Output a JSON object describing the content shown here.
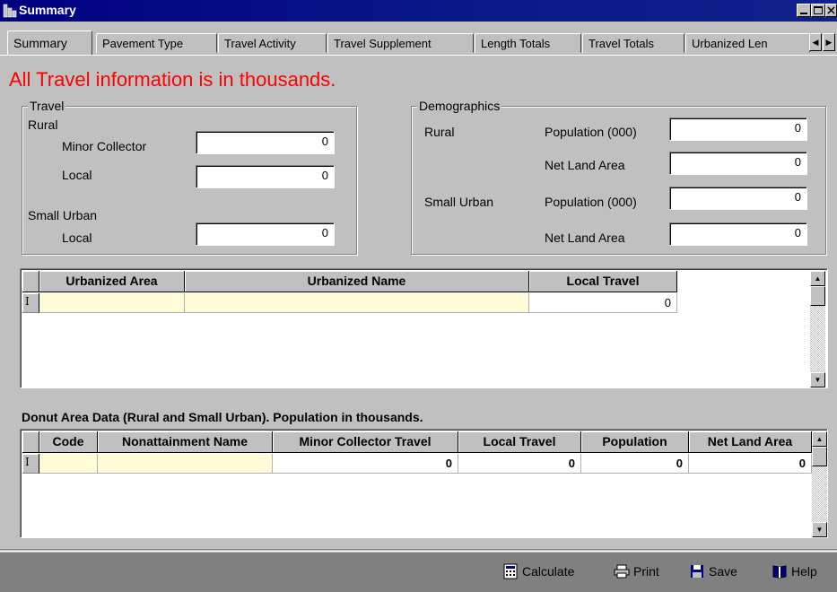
{
  "window": {
    "title": "Summary"
  },
  "tabs": [
    {
      "label": "Summary"
    },
    {
      "label": "Pavement Type"
    },
    {
      "label": "Travel Activity"
    },
    {
      "label": "Travel Supplement"
    },
    {
      "label": "Length Totals"
    },
    {
      "label": "Travel Totals"
    },
    {
      "label": "Urbanized Len"
    }
  ],
  "notice": "All Travel information is in thousands.",
  "travel": {
    "title": "Travel",
    "rural_label": "Rural",
    "minor_collector_label": "Minor Collector",
    "minor_collector_value": "0",
    "rural_local_label": "Local",
    "rural_local_value": "0",
    "small_urban_label": "Small Urban",
    "small_urban_local_label": "Local",
    "small_urban_local_value": "0"
  },
  "demographics": {
    "title": "Demographics",
    "rural_label": "Rural",
    "rural_population_label": "Population (000)",
    "rural_population_value": "0",
    "rural_net_land_label": "Net Land Area",
    "rural_net_land_value": "0",
    "small_urban_label": "Small Urban",
    "small_urban_population_label": "Population (000)",
    "small_urban_population_value": "0",
    "small_urban_net_land_label": "Net Land Area",
    "small_urban_net_land_value": "0"
  },
  "urbanized_grid": {
    "columns": [
      "Urbanized Area",
      "Urbanized Name",
      "Local Travel"
    ],
    "rows": [
      {
        "area": "",
        "name": "",
        "local_travel": "0"
      }
    ],
    "row_marker": "I"
  },
  "donut_section_title": "Donut Area Data (Rural and Small Urban). Population in thousands.",
  "donut_grid": {
    "columns": [
      "Code",
      "Nonattainment Name",
      "Minor Collector Travel",
      "Local Travel",
      "Population",
      "Net Land Area"
    ],
    "rows": [
      {
        "code": "",
        "name": "",
        "minor_collector_travel": "0",
        "local_travel": "0",
        "population": "0",
        "net_land_area": "0"
      }
    ],
    "row_marker": "I"
  },
  "toolbar": {
    "calculate_label": "Calculate",
    "print_label": "Print",
    "save_label": "Save",
    "help_label": "Help"
  },
  "colors": {
    "title_bar": "#000080",
    "notice_text": "#ff0000",
    "cell_highlight": "#fffbd8",
    "face": "#c0c0c0"
  }
}
